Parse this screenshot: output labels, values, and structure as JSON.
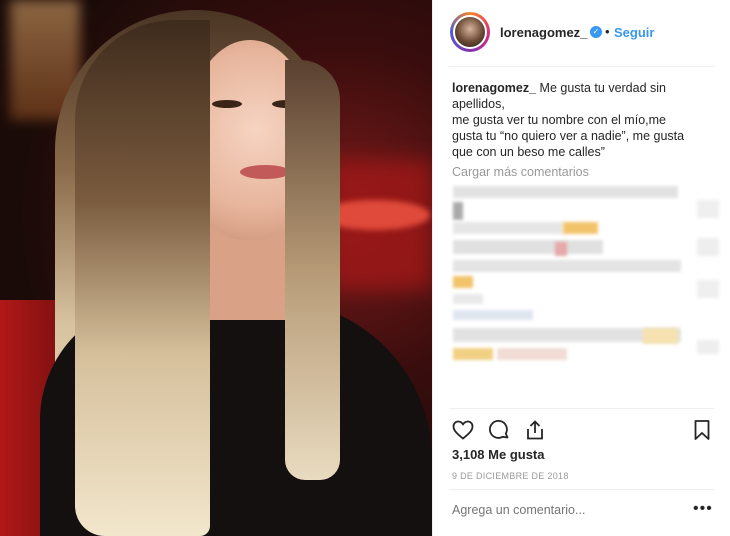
{
  "post": {
    "username": "lorenagomez_",
    "verified_icon": "verified-badge-icon",
    "separator": "•",
    "follow_label": "Seguir",
    "caption_user": "lorenagomez_",
    "caption_lines": [
      " Me gusta tu verdad sin",
      "apellidos,",
      "me gusta ver tu nombre con el mío,me",
      "gusta tu “no quiero ver a nadie”, me gusta",
      "que con un beso me calles”"
    ],
    "load_more": "Cargar más comentarios",
    "likes": "3,108 Me gusta",
    "date": "9 DE DICIEMBRE DE 2018",
    "comment_placeholder": "Agrega un comentario...",
    "more_label": "•••"
  },
  "icons": {
    "like": "heart-icon",
    "comment": "comment-bubble-icon",
    "share": "share-icon",
    "save": "bookmark-icon"
  },
  "colors": {
    "link": "#3897f0",
    "text": "#262626",
    "muted": "#999999",
    "divider": "#efefef"
  }
}
